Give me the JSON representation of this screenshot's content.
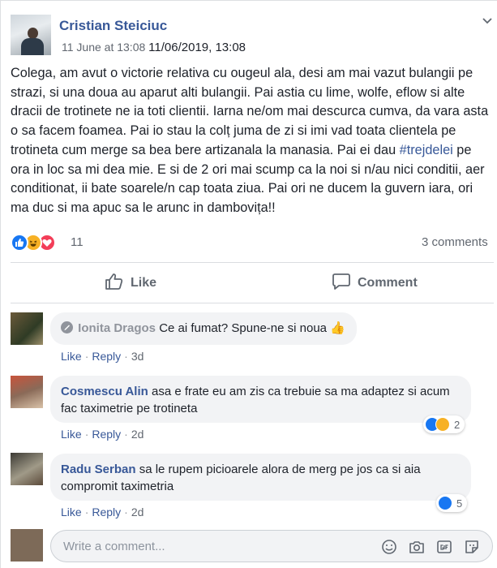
{
  "post": {
    "author": "Cristian Steiciuc",
    "timestamp": "11 June at 13:08",
    "timestamp_full": "11/06/2019, 13:08",
    "text_before": "Colega, am avut o victorie relativa cu ougeul ala, desi am mai vazut bulangii pe strazi, si una doua au aparut alti bulangii. Pai astia cu lime, wolfe, eflow si alte dracii de trotinete ne ia toti clientii. Iarna ne/om mai descurca cumva, da vara asta o sa facem foamea. Pai io stau la colț juma de zi si imi vad toata clientela pe trotineta cum merge sa bea bere artizanala la manasia. Pai ei dau ",
    "hashtag": "#trejdelei",
    "text_after": " pe ora in loc sa mi dea mie. E si de 2 ori mai scump ca la noi si n/au nici conditii, aer conditionat, ii bate soarele/n cap toata ziua. Pai ori ne ducem la guvern iara, ori ma duc si ma apuc sa le arunc in dambovița!!",
    "reaction_count": "11",
    "comments_count": "3 comments",
    "reactions": [
      "like",
      "haha",
      "love"
    ]
  },
  "actions": {
    "like_label": "Like",
    "comment_label": "Comment"
  },
  "comments": [
    {
      "name": "Ionita Dragos",
      "text": "Ce ai fumat? Spune-ne si noua",
      "emoji": "👍",
      "like_label": "Like",
      "reply_label": "Reply",
      "age": "3d"
    },
    {
      "name": "Cosmescu Alin",
      "text": "asa e frate eu am zis ca trebuie sa ma adaptez si acum fac taximetrie pe trotineta",
      "like_label": "Like",
      "reply_label": "Reply",
      "age": "2d",
      "reaction_count": "2",
      "reactions": [
        "like",
        "haha"
      ]
    },
    {
      "name": "Radu Serban",
      "text": "sa le rupem picioarele alora de merg pe jos ca si aia compromit taximetria",
      "like_label": "Like",
      "reply_label": "Reply",
      "age": "2d",
      "reaction_count": "5",
      "reactions": [
        "like"
      ]
    }
  ],
  "write_comment": {
    "placeholder": "Write a comment...",
    "tools": [
      "emoji-icon",
      "camera-icon",
      "gif-icon",
      "sticker-icon"
    ]
  },
  "colors": {
    "link": "#385898",
    "like_blue": "#1877f2",
    "haha_yellow": "#f7b125",
    "love_red": "#f33e58"
  }
}
